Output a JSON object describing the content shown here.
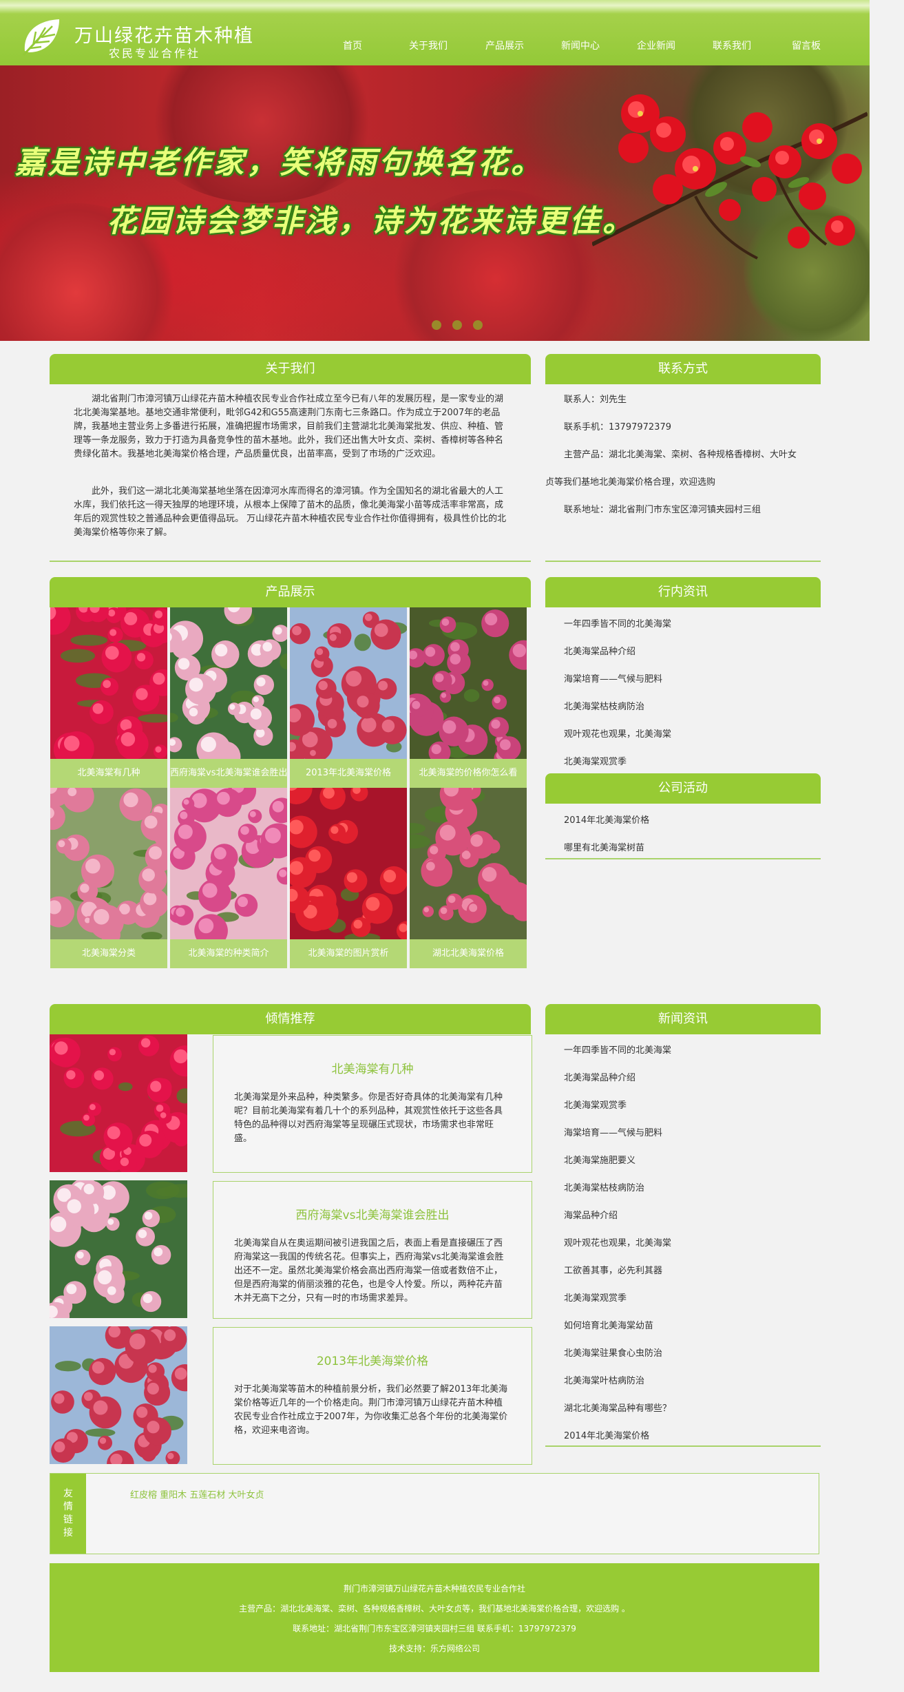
{
  "header": {
    "site_title": "万山绿花卉苗木种植",
    "site_subtitle": "农民专业合作社",
    "nav": [
      "首页",
      "关于我们",
      "产品展示",
      "新闻中心",
      "企业新闻",
      "联系我们",
      "留言板"
    ]
  },
  "banner": {
    "line1": "嘉是诗中老作家，笑将雨句换名花。",
    "line2": "花园诗会梦非浅，诗为花来诗更佳。",
    "dots": 3
  },
  "about": {
    "title": "关于我们",
    "p1": "湖北省荆门市漳河镇万山绿花卉苗木种植农民专业合作社成立至今已有八年的发展历程，是一家专业的湖北北美海棠基地。基地交通非常便利，毗邻G42和G55高速荆门东南七三条路口。作为成立于2007年的老品牌，我基地主营业务上多番进行拓展，准确把握市场需求，目前我们主营湖北北美海棠批发、供应、种植、管理等一条龙服务，致力于打造为具备竞争性的苗木基地。此外，我们还出售大叶女贞、栾树、香樟树等各种名贵绿化苗木。我基地北美海棠价格合理，产品质量优良，出苗率高，受到了市场的广泛欢迎。",
    "p2": "此外，我们这一湖北北美海棠基地坐落在因漳河水库而得名的漳河镇。作为全国知名的湖北省最大的人工水库，我们依托这一得天独厚的地理环境，从根本上保障了苗木的品质，像北美海棠小苗等成活率非常高，成年后的观赏性较之普通品种会更值得品玩。 万山绿花卉苗木种植农民专业合作社你值得拥有，极具性价比的北美海棠价格等你来了解。"
  },
  "contact": {
    "title": "联系方式",
    "person": "联系人：刘先生",
    "phone": "联系手机：13797972379",
    "products_a": "主营产品：湖北北美海棠、栾树、各种规格香樟树、大叶女",
    "products_b": "贞等我们基地北美海棠价格合理，欢迎选购",
    "address": "联系地址：湖北省荆门市东宝区漳河镇夹园村三组"
  },
  "products": {
    "title": "产品展示",
    "items": [
      "北美海棠有几种",
      "西府海棠vs北美海棠谁会胜出",
      "2013年北美海棠价格",
      "北美海棠的价格你怎么看",
      "北美海棠分类",
      "北美海棠的种类简介",
      "北美海棠的图片赏析",
      "湖北北美海棠价格"
    ]
  },
  "industry": {
    "title": "行内资讯",
    "items": [
      "一年四季皆不同的北美海棠",
      "北美海棠品种介绍",
      "海棠培育——气候与肥料",
      "北美海棠枯枝病防治",
      "观叶观花也观果，北美海棠",
      "北美海棠观赏季"
    ]
  },
  "activities": {
    "title": "公司活动",
    "items": [
      "2014年北美海棠价格",
      "哪里有北美海棠树苗"
    ]
  },
  "recommend": {
    "title": "倾情推荐",
    "items": [
      {
        "title": "北美海棠有几种",
        "desc": "北美海棠是外来品种，种类繁多。你是否好奇具体的北美海棠有几种呢？目前北美海棠有着几十个的系列品种，其观赏性依托于这些各具特色的品种得以对西府海棠等呈现碾压式现状，市场需求也非常旺盛。"
      },
      {
        "title": "西府海棠vs北美海棠谁会胜出",
        "desc": "北美海棠自从在奥运期间被引进我国之后，表面上看是直接碾压了西府海棠这一我国的传统名花。但事实上，西府海棠vs北美海棠谁会胜出还不一定。虽然北美海棠价格会高出西府海棠一倍或者数倍不止，但是西府海棠的俏丽淡雅的花色，也是令人怜爱。所以，两种花卉苗木并无高下之分，只有一时的市场需求差异。"
      },
      {
        "title": "2013年北美海棠价格",
        "desc": "对于北美海棠等苗木的种植前景分析，我们必然要了解2013年北美海棠价格等近几年的一个价格走向。荆门市漳河镇万山绿花卉苗木种植农民专业合作社成立于2007年，为你收集汇总各个年份的北美海棠价格，欢迎来电咨询。"
      }
    ]
  },
  "news": {
    "title": "新闻资讯",
    "items": [
      "一年四季皆不同的北美海棠",
      "北美海棠品种介绍",
      "北美海棠观赏季",
      "海棠培育——气候与肥料",
      "北美海棠施肥要义",
      "北美海棠枯枝病防治",
      "海棠品种介绍",
      "观叶观花也观果，北美海棠",
      "工欲善其事，必先利其器",
      "北美海棠观赏季",
      "如何培育北美海棠幼苗",
      "北美海棠驻果食心虫防治",
      "北美海棠叶枯病防治",
      "湖北北美海棠品种有哪些？",
      "2014年北美海棠价格"
    ]
  },
  "links": {
    "label": "友情链接",
    "items": [
      "红皮榕",
      "重阳木",
      "五莲石材",
      "大叶女贞"
    ]
  },
  "footer": {
    "line1": "荆门市漳河镇万山绿花卉苗木种植农民专业合作社",
    "line2": "主营产品：湖北北美海棠、栾树、各种规格香樟树、大叶女贞等，我们基地北美海棠价格合理，欢迎选购 。",
    "line3": "联系地址：湖北省荆门市东宝区漳河镇夹园村三组  联系手机：13797972379",
    "line4": "技术支持：乐方网络公司"
  },
  "colors": {
    "accent": "#97cb34",
    "caption": "#b4d875",
    "link": "#8dc23c"
  }
}
